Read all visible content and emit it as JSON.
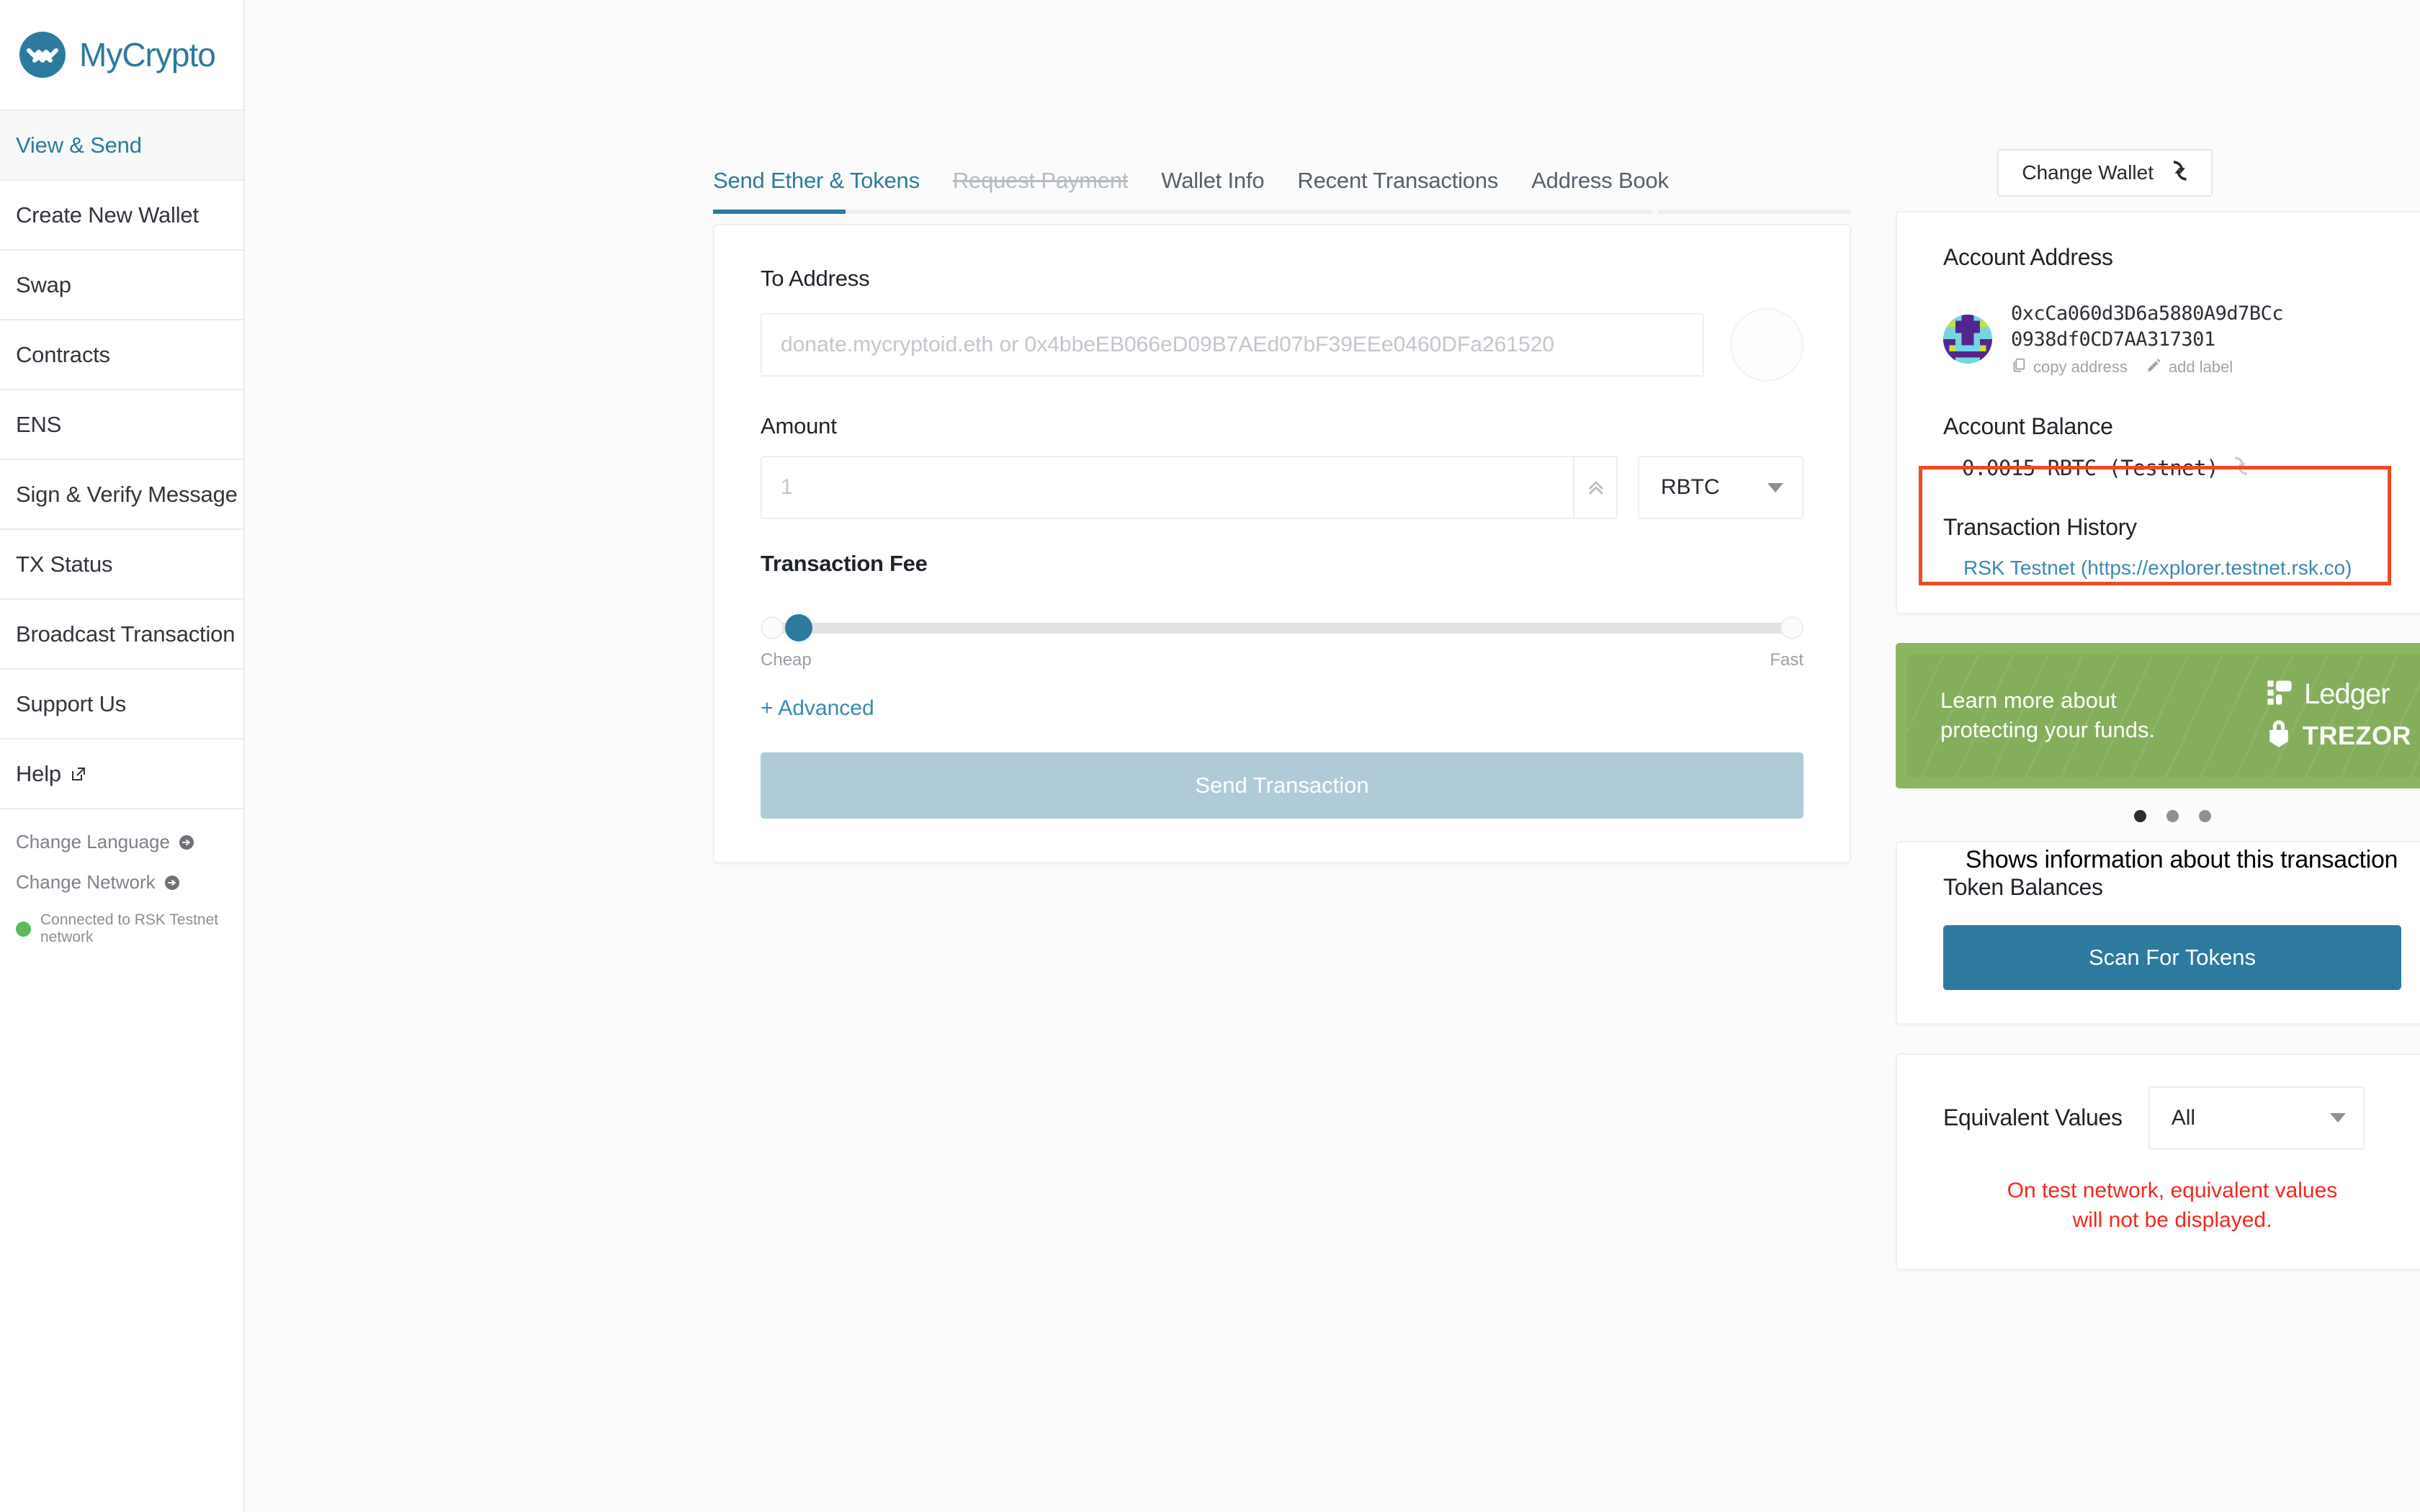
{
  "brand": {
    "name": "MyCrypto"
  },
  "sidebar": {
    "items": [
      {
        "label": "View & Send",
        "active": true
      },
      {
        "label": "Create New Wallet",
        "active": false
      },
      {
        "label": "Swap",
        "active": false
      },
      {
        "label": "Contracts",
        "active": false
      },
      {
        "label": "ENS",
        "active": false
      },
      {
        "label": "Sign & Verify Message",
        "active": false
      },
      {
        "label": "TX Status",
        "active": false
      },
      {
        "label": "Broadcast Transaction",
        "active": false
      },
      {
        "label": "Support Us",
        "active": false
      },
      {
        "label": "Help",
        "active": false,
        "external": true
      }
    ],
    "sub_links": [
      {
        "label": "Change Language"
      },
      {
        "label": "Change Network"
      }
    ],
    "connection_status": "Connected to RSK Testnet network"
  },
  "toolbar": {
    "change_wallet_label": "Change Wallet",
    "change_wallet_icon": "refresh-icon"
  },
  "tabs": [
    {
      "label": "Send Ether & Tokens",
      "state": "active"
    },
    {
      "label": "Request Payment",
      "state": "disabled"
    },
    {
      "label": "Wallet Info",
      "state": "normal"
    },
    {
      "label": "Recent Transactions",
      "state": "normal"
    },
    {
      "label": "Address Book",
      "state": "normal"
    }
  ],
  "send_form": {
    "to_address_label": "To Address",
    "to_address_value": "",
    "to_address_placeholder": "donate.mycryptoid.eth or 0x4bbeEB066eD09B7AEd07bF39EEe0460DFa261520",
    "amount_label": "Amount",
    "amount_value": "",
    "amount_placeholder": "1",
    "unit_selected": "RBTC",
    "fee_label": "Transaction Fee",
    "fee_low_label": "Cheap",
    "fee_high_label": "Fast",
    "fee_slider_percent": 0,
    "advanced_label": "+ Advanced",
    "send_button_label": "Send Transaction"
  },
  "account_panel": {
    "title": "Account Address",
    "address_line1": "0xcCa060d3D6a5880A9d7BCc",
    "address_line2": "0938df0CD7AA317301",
    "copy_label": "copy address",
    "add_label_label": "add label",
    "balance_title": "Account Balance",
    "balance_value": "0.0015 RBTC (Testnet)",
    "refresh_icon": "refresh-icon",
    "tx_history_title": "Transaction History",
    "tx_history_link": "RSK Testnet (https://explorer.testnet.rsk.co)"
  },
  "annotation": {
    "text": "Shows information about this transaction",
    "box_color": "#f04a24"
  },
  "promo": {
    "text_line1": "Learn more about",
    "text_line2": "protecting your funds.",
    "ledger_label": "Ledger",
    "trezor_label": "TREZOR",
    "bg_color": "#8bb560",
    "active_dot_index": 0
  },
  "token_panel": {
    "title": "Token Balances",
    "scan_button_label": "Scan For Tokens"
  },
  "equivalent_panel": {
    "label": "Equivalent Values",
    "selected": "All",
    "warning_line1": "On test network, equivalent values",
    "warning_line2": "will not be displayed."
  },
  "colors": {
    "accent": "#2d7a9e",
    "promo_green": "#8bb560",
    "warning_red": "#f2281d",
    "annotation_red": "#f04a24",
    "connected_green": "#5aba5a"
  }
}
